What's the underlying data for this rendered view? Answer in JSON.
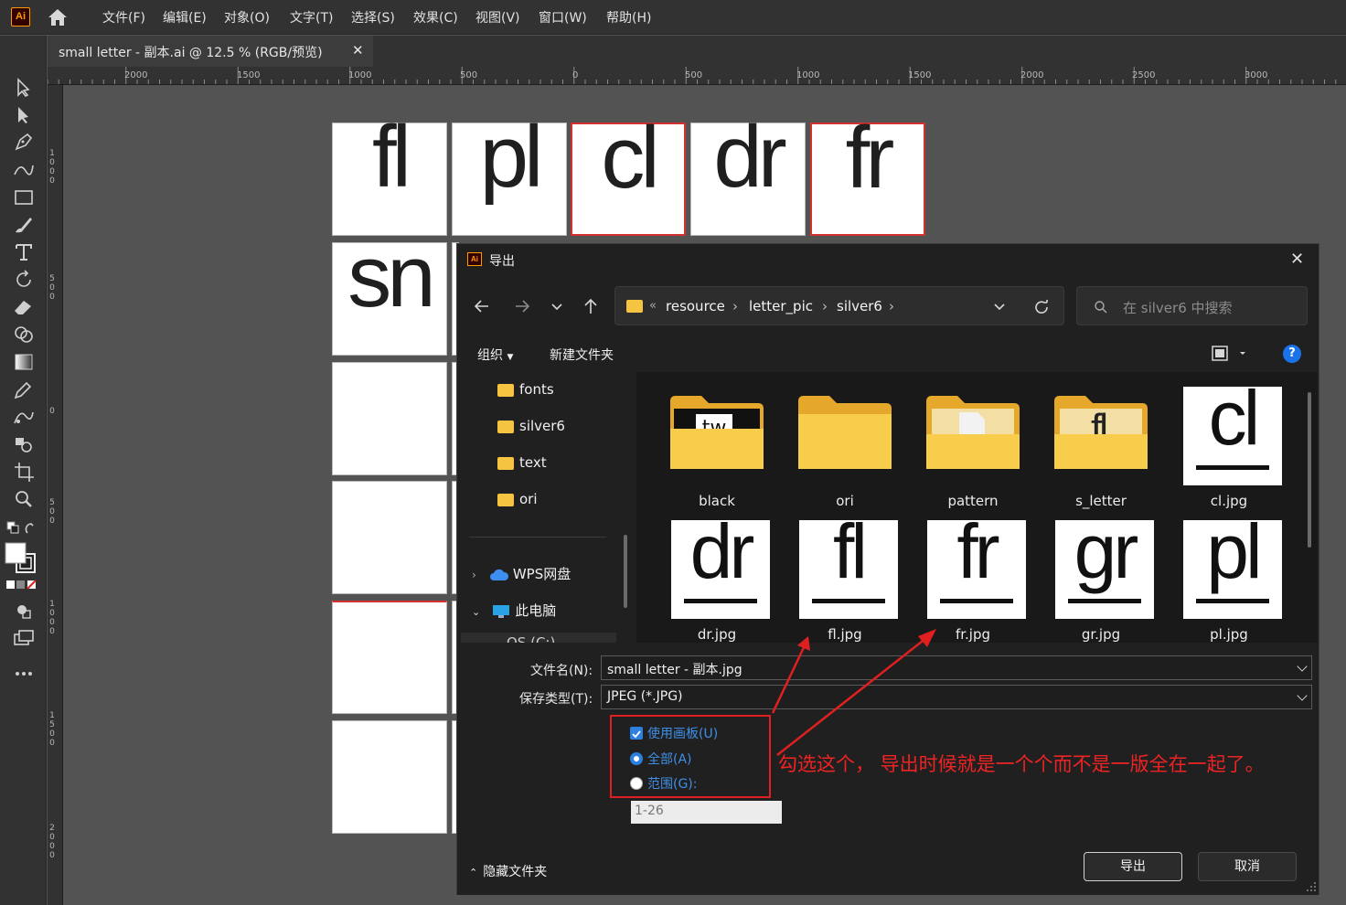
{
  "app": {
    "logo": "Ai",
    "menus": [
      "文件(F)",
      "编辑(E)",
      "对象(O)",
      "文字(T)",
      "选择(S)",
      "效果(C)",
      "视图(V)",
      "窗口(W)",
      "帮助(H)"
    ],
    "doc_tab": "small letter - 副本.ai @ 12.5 % (RGB/预览)",
    "doc_tab_close": "✕"
  },
  "rulers": {
    "h_labels": [
      "2000",
      "1500",
      "1000",
      "500",
      "0",
      "500",
      "1000",
      "1500",
      "2000",
      "2500",
      "3000"
    ],
    "v_labels": [
      "1000",
      "500",
      "0",
      "500",
      "1000",
      "1500",
      "2000"
    ]
  },
  "artboards": {
    "row1": [
      "fl",
      "pl",
      "cl",
      "dr",
      "fr"
    ],
    "row2_first": "sn"
  },
  "dialog": {
    "title": "导出",
    "close": "✕",
    "breadcrumb": [
      "resource",
      "letter_pic",
      "silver6"
    ],
    "breadcrumb_prefix": "«",
    "search_placeholder": "在 silver6 中搜索",
    "organize": "组织",
    "new_folder": "新建文件夹",
    "help": "?",
    "nav_folders": [
      "fonts",
      "silver6",
      "text",
      "ori"
    ],
    "nav_cloud": "WPS网盘",
    "nav_pc": "此电脑",
    "nav_partial": "OS (C:)",
    "files_row1": [
      {
        "name": "black",
        "kind": "folder-image",
        "preview": "tw"
      },
      {
        "name": "ori",
        "kind": "folder"
      },
      {
        "name": "pattern",
        "kind": "folder-doc"
      },
      {
        "name": "s_letter",
        "kind": "folder-image",
        "preview": "fl"
      },
      {
        "name": "cl.jpg",
        "kind": "image",
        "letter": "cl"
      }
    ],
    "files_row2": [
      {
        "name": "dr.jpg",
        "letter": "dr"
      },
      {
        "name": "fl.jpg",
        "letter": "fl"
      },
      {
        "name": "fr.jpg",
        "letter": "fr"
      },
      {
        "name": "gr.jpg",
        "letter": "gr"
      },
      {
        "name": "pl.jpg",
        "letter": "pl"
      }
    ],
    "filename_label": "文件名(N):",
    "filename_value": "small letter - 副本.jpg",
    "filetype_label": "保存类型(T):",
    "filetype_value": "JPEG (*.JPG)",
    "use_artboards": "使用画板(U)",
    "all": "全部(A)",
    "range": "范围(G):",
    "range_value": "1-26",
    "hide_folders": "隐藏文件夹",
    "export_button": "导出",
    "cancel_button": "取消"
  },
  "annotation": {
    "note": "勾选这个， 导出时候就是一个个而不是一版全在一起了。",
    "color": "#e02020"
  }
}
